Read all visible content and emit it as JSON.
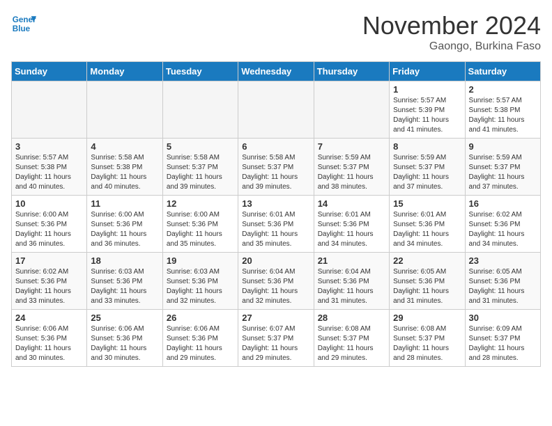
{
  "header": {
    "logo_line1": "General",
    "logo_line2": "Blue",
    "month": "November 2024",
    "location": "Gaongo, Burkina Faso"
  },
  "days_of_week": [
    "Sunday",
    "Monday",
    "Tuesday",
    "Wednesday",
    "Thursday",
    "Friday",
    "Saturday"
  ],
  "weeks": [
    [
      {
        "day": "",
        "empty": true
      },
      {
        "day": "",
        "empty": true
      },
      {
        "day": "",
        "empty": true
      },
      {
        "day": "",
        "empty": true
      },
      {
        "day": "",
        "empty": true
      },
      {
        "day": "1",
        "sunrise": "5:57 AM",
        "sunset": "5:39 PM",
        "daylight": "11 hours and 41 minutes."
      },
      {
        "day": "2",
        "sunrise": "5:57 AM",
        "sunset": "5:38 PM",
        "daylight": "11 hours and 41 minutes."
      }
    ],
    [
      {
        "day": "3",
        "sunrise": "5:57 AM",
        "sunset": "5:38 PM",
        "daylight": "11 hours and 40 minutes."
      },
      {
        "day": "4",
        "sunrise": "5:58 AM",
        "sunset": "5:38 PM",
        "daylight": "11 hours and 40 minutes."
      },
      {
        "day": "5",
        "sunrise": "5:58 AM",
        "sunset": "5:37 PM",
        "daylight": "11 hours and 39 minutes."
      },
      {
        "day": "6",
        "sunrise": "5:58 AM",
        "sunset": "5:37 PM",
        "daylight": "11 hours and 39 minutes."
      },
      {
        "day": "7",
        "sunrise": "5:59 AM",
        "sunset": "5:37 PM",
        "daylight": "11 hours and 38 minutes."
      },
      {
        "day": "8",
        "sunrise": "5:59 AM",
        "sunset": "5:37 PM",
        "daylight": "11 hours and 37 minutes."
      },
      {
        "day": "9",
        "sunrise": "5:59 AM",
        "sunset": "5:37 PM",
        "daylight": "11 hours and 37 minutes."
      }
    ],
    [
      {
        "day": "10",
        "sunrise": "6:00 AM",
        "sunset": "5:36 PM",
        "daylight": "11 hours and 36 minutes."
      },
      {
        "day": "11",
        "sunrise": "6:00 AM",
        "sunset": "5:36 PM",
        "daylight": "11 hours and 36 minutes."
      },
      {
        "day": "12",
        "sunrise": "6:00 AM",
        "sunset": "5:36 PM",
        "daylight": "11 hours and 35 minutes."
      },
      {
        "day": "13",
        "sunrise": "6:01 AM",
        "sunset": "5:36 PM",
        "daylight": "11 hours and 35 minutes."
      },
      {
        "day": "14",
        "sunrise": "6:01 AM",
        "sunset": "5:36 PM",
        "daylight": "11 hours and 34 minutes."
      },
      {
        "day": "15",
        "sunrise": "6:01 AM",
        "sunset": "5:36 PM",
        "daylight": "11 hours and 34 minutes."
      },
      {
        "day": "16",
        "sunrise": "6:02 AM",
        "sunset": "5:36 PM",
        "daylight": "11 hours and 34 minutes."
      }
    ],
    [
      {
        "day": "17",
        "sunrise": "6:02 AM",
        "sunset": "5:36 PM",
        "daylight": "11 hours and 33 minutes."
      },
      {
        "day": "18",
        "sunrise": "6:03 AM",
        "sunset": "5:36 PM",
        "daylight": "11 hours and 33 minutes."
      },
      {
        "day": "19",
        "sunrise": "6:03 AM",
        "sunset": "5:36 PM",
        "daylight": "11 hours and 32 minutes."
      },
      {
        "day": "20",
        "sunrise": "6:04 AM",
        "sunset": "5:36 PM",
        "daylight": "11 hours and 32 minutes."
      },
      {
        "day": "21",
        "sunrise": "6:04 AM",
        "sunset": "5:36 PM",
        "daylight": "11 hours and 31 minutes."
      },
      {
        "day": "22",
        "sunrise": "6:05 AM",
        "sunset": "5:36 PM",
        "daylight": "11 hours and 31 minutes."
      },
      {
        "day": "23",
        "sunrise": "6:05 AM",
        "sunset": "5:36 PM",
        "daylight": "11 hours and 31 minutes."
      }
    ],
    [
      {
        "day": "24",
        "sunrise": "6:06 AM",
        "sunset": "5:36 PM",
        "daylight": "11 hours and 30 minutes."
      },
      {
        "day": "25",
        "sunrise": "6:06 AM",
        "sunset": "5:36 PM",
        "daylight": "11 hours and 30 minutes."
      },
      {
        "day": "26",
        "sunrise": "6:06 AM",
        "sunset": "5:36 PM",
        "daylight": "11 hours and 29 minutes."
      },
      {
        "day": "27",
        "sunrise": "6:07 AM",
        "sunset": "5:37 PM",
        "daylight": "11 hours and 29 minutes."
      },
      {
        "day": "28",
        "sunrise": "6:08 AM",
        "sunset": "5:37 PM",
        "daylight": "11 hours and 29 minutes."
      },
      {
        "day": "29",
        "sunrise": "6:08 AM",
        "sunset": "5:37 PM",
        "daylight": "11 hours and 28 minutes."
      },
      {
        "day": "30",
        "sunrise": "6:09 AM",
        "sunset": "5:37 PM",
        "daylight": "11 hours and 28 minutes."
      }
    ]
  ]
}
